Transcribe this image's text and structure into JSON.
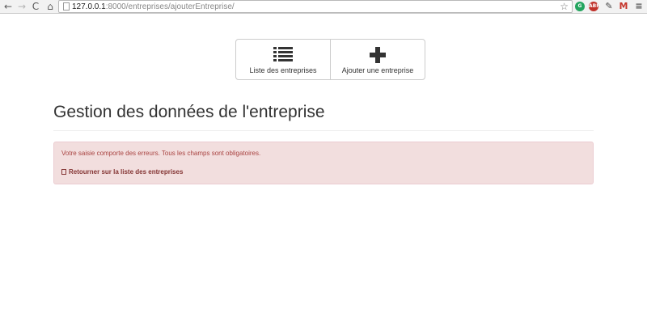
{
  "browser": {
    "url_host": "127.0.0.1",
    "url_rest": ":8000/entreprises/ajouterEntreprise/",
    "back_glyph": "←",
    "forward_glyph": "→",
    "reload_glyph": "C",
    "home_glyph": "⌂",
    "star_glyph": "☆",
    "extensions": [
      "grammarly-icon",
      "adblock-icon",
      "pen-icon",
      "gmail-icon",
      "menu-icon"
    ]
  },
  "toolbar": {
    "list_label": "Liste des entreprises",
    "add_label": "Ajouter une entreprise"
  },
  "page": {
    "title": "Gestion des données de l'entreprise"
  },
  "alert": {
    "message": "Votre saisie comporte des erreurs. Tous les champs sont obligatoires.",
    "back_link": "Retourner sur la liste des entreprises",
    "bg_color": "#f2dede",
    "text_color": "#a94442"
  }
}
